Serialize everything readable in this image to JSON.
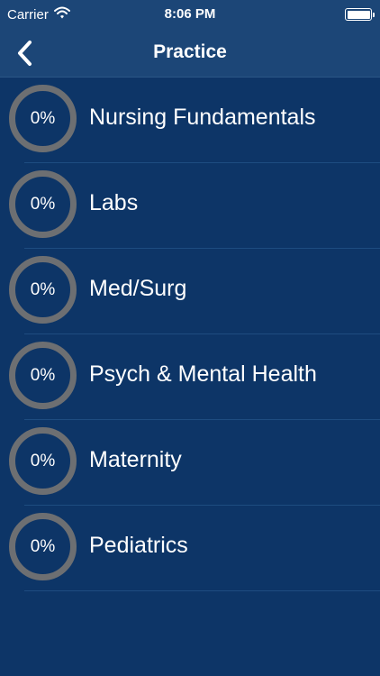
{
  "status_bar": {
    "carrier": "Carrier",
    "time": "8:06 PM",
    "battery_level": 1.0
  },
  "nav": {
    "title": "Practice",
    "back_icon": "chevron-left-icon"
  },
  "categories": [
    {
      "label": "Nursing Fundamentals",
      "progress": "0%"
    },
    {
      "label": "Labs",
      "progress": "0%"
    },
    {
      "label": "Med/Surg",
      "progress": "0%"
    },
    {
      "label": "Psych & Mental Health",
      "progress": "0%"
    },
    {
      "label": "Maternity",
      "progress": "0%"
    },
    {
      "label": "Pediatrics",
      "progress": "0%"
    }
  ],
  "colors": {
    "background": "#0d3567",
    "bar": "#1c4677",
    "ring": "#6d6f72",
    "separator": "#1e4c80"
  }
}
